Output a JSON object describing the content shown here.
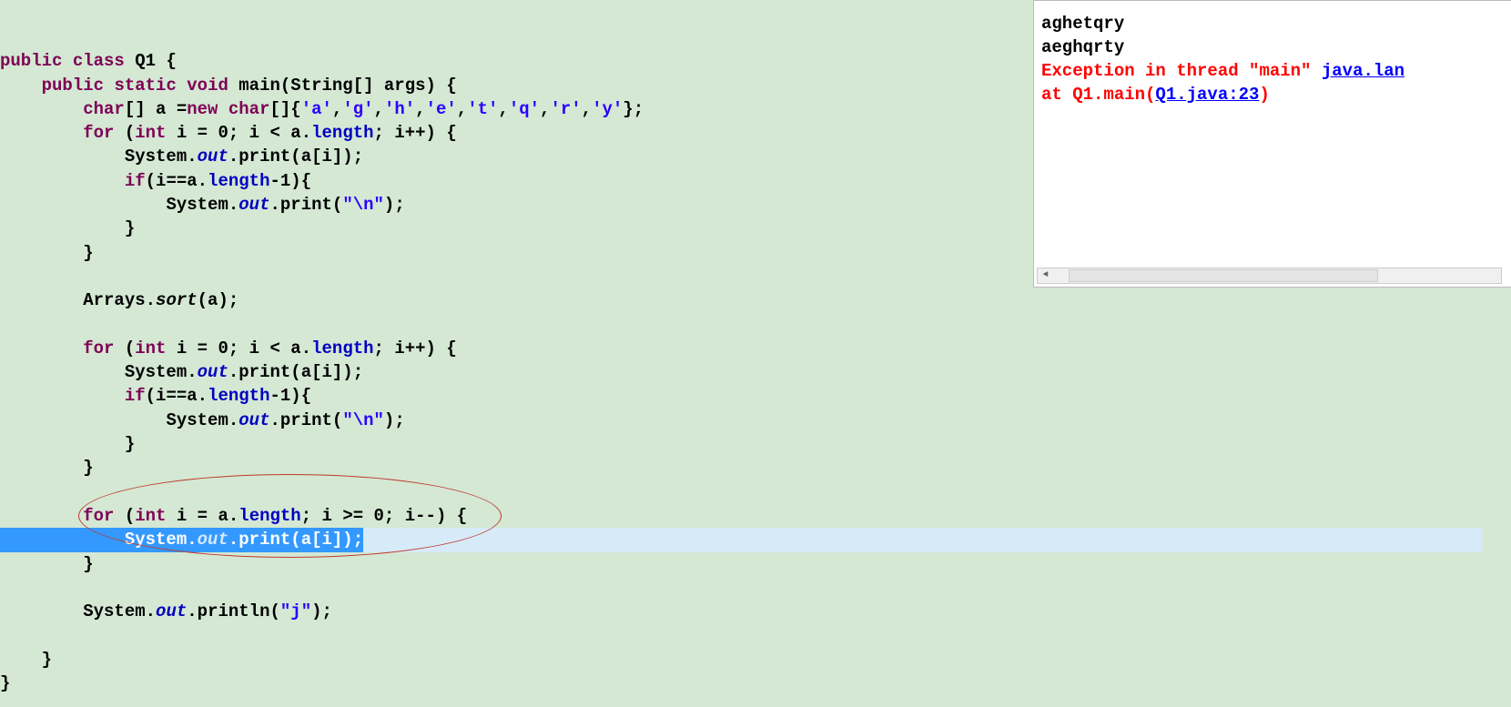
{
  "code": {
    "line1": {
      "kw1": "public",
      "kw2": "class",
      "name": "Q1",
      "brace": " {"
    },
    "line2": {
      "indent": "    ",
      "kw1": "public",
      "kw2": "static",
      "kw3": "void",
      "method": "main",
      "params": "(String[] args) {"
    },
    "line3": {
      "indent": "        ",
      "kw1": "char",
      "arr": "[] a =",
      "kw2": "new",
      "kw3": "char",
      "open": "[]{",
      "c1": "'a'",
      "s1": ",",
      "c2": "'g'",
      "s2": ",",
      "c3": "'h'",
      "s3": ",",
      "c4": "'e'",
      "s4": ",",
      "c5": "'t'",
      "s5": ",",
      "c6": "'q'",
      "s6": ",",
      "c7": "'r'",
      "s7": ",",
      "c8": "'y'",
      "close": "};"
    },
    "line4": {
      "indent": "        ",
      "kw": "for",
      "open": " (",
      "kw2": "int",
      "cond": " i = 0; i < a.",
      "field": "length",
      "rest": "; i++) {"
    },
    "line5": {
      "indent": "            ",
      "sys": "System.",
      "field": "out",
      "rest": ".print(a[i]);"
    },
    "line6": {
      "indent": "            ",
      "kw": "if",
      "cond": "(i==a.",
      "field": "length",
      "rest": "-1){"
    },
    "line7": {
      "indent": "                ",
      "sys": "System.",
      "field": "out",
      "print": ".print(",
      "str": "\"\\n\"",
      "end": ");"
    },
    "line8": {
      "indent": "            ",
      "brace": "}"
    },
    "line9": {
      "indent": "        ",
      "brace": "}"
    },
    "line10": {
      "text": ""
    },
    "line11": {
      "indent": "        ",
      "pre": "Arrays.",
      "sort": "sort",
      "post": "(a);"
    },
    "line12": {
      "text": ""
    },
    "line13": {
      "indent": "        ",
      "kw": "for",
      "open": " (",
      "kw2": "int",
      "cond": " i = 0; i < a.",
      "field": "length",
      "rest": "; i++) {"
    },
    "line14": {
      "indent": "            ",
      "sys": "System.",
      "field": "out",
      "rest": ".print(a[i]);"
    },
    "line15": {
      "indent": "            ",
      "kw": "if",
      "cond": "(i==a.",
      "field": "length",
      "rest": "-1){"
    },
    "line16": {
      "indent": "                ",
      "sys": "System.",
      "field": "out",
      "print": ".print(",
      "str": "\"\\n\"",
      "end": ");"
    },
    "line17": {
      "indent": "            ",
      "brace": "}"
    },
    "line18": {
      "indent": "        ",
      "brace": "}"
    },
    "line19": {
      "text": ""
    },
    "line20": {
      "indent": "        ",
      "kw": "for",
      "open": " (",
      "kw2": "int",
      "cond": " i = a.",
      "field": "length",
      "rest": "; i >= 0; i--) {"
    },
    "line21": {
      "indent": "            ",
      "sys": "System.",
      "field": "out",
      "rest": ".print(a[i]);"
    },
    "line22": {
      "indent": "        ",
      "brace": "}"
    },
    "line23": {
      "text": ""
    },
    "line24": {
      "indent": "        ",
      "sys": "System.",
      "field": "out",
      "print": ".println(",
      "str": "\"j\"",
      "end": ");"
    },
    "line25": {
      "text": ""
    },
    "line26": {
      "indent": "    ",
      "brace": "}"
    },
    "line27": {
      "brace": "}"
    }
  },
  "console": {
    "line1": "aghetqry",
    "line2": "aeghqrty",
    "line3_pre": "Exception in thread \"main\" ",
    "line3_link": "java.lan",
    "line4_pre": "        at Q1.main(",
    "line4_link": "Q1.java:23",
    "line4_post": ")"
  }
}
